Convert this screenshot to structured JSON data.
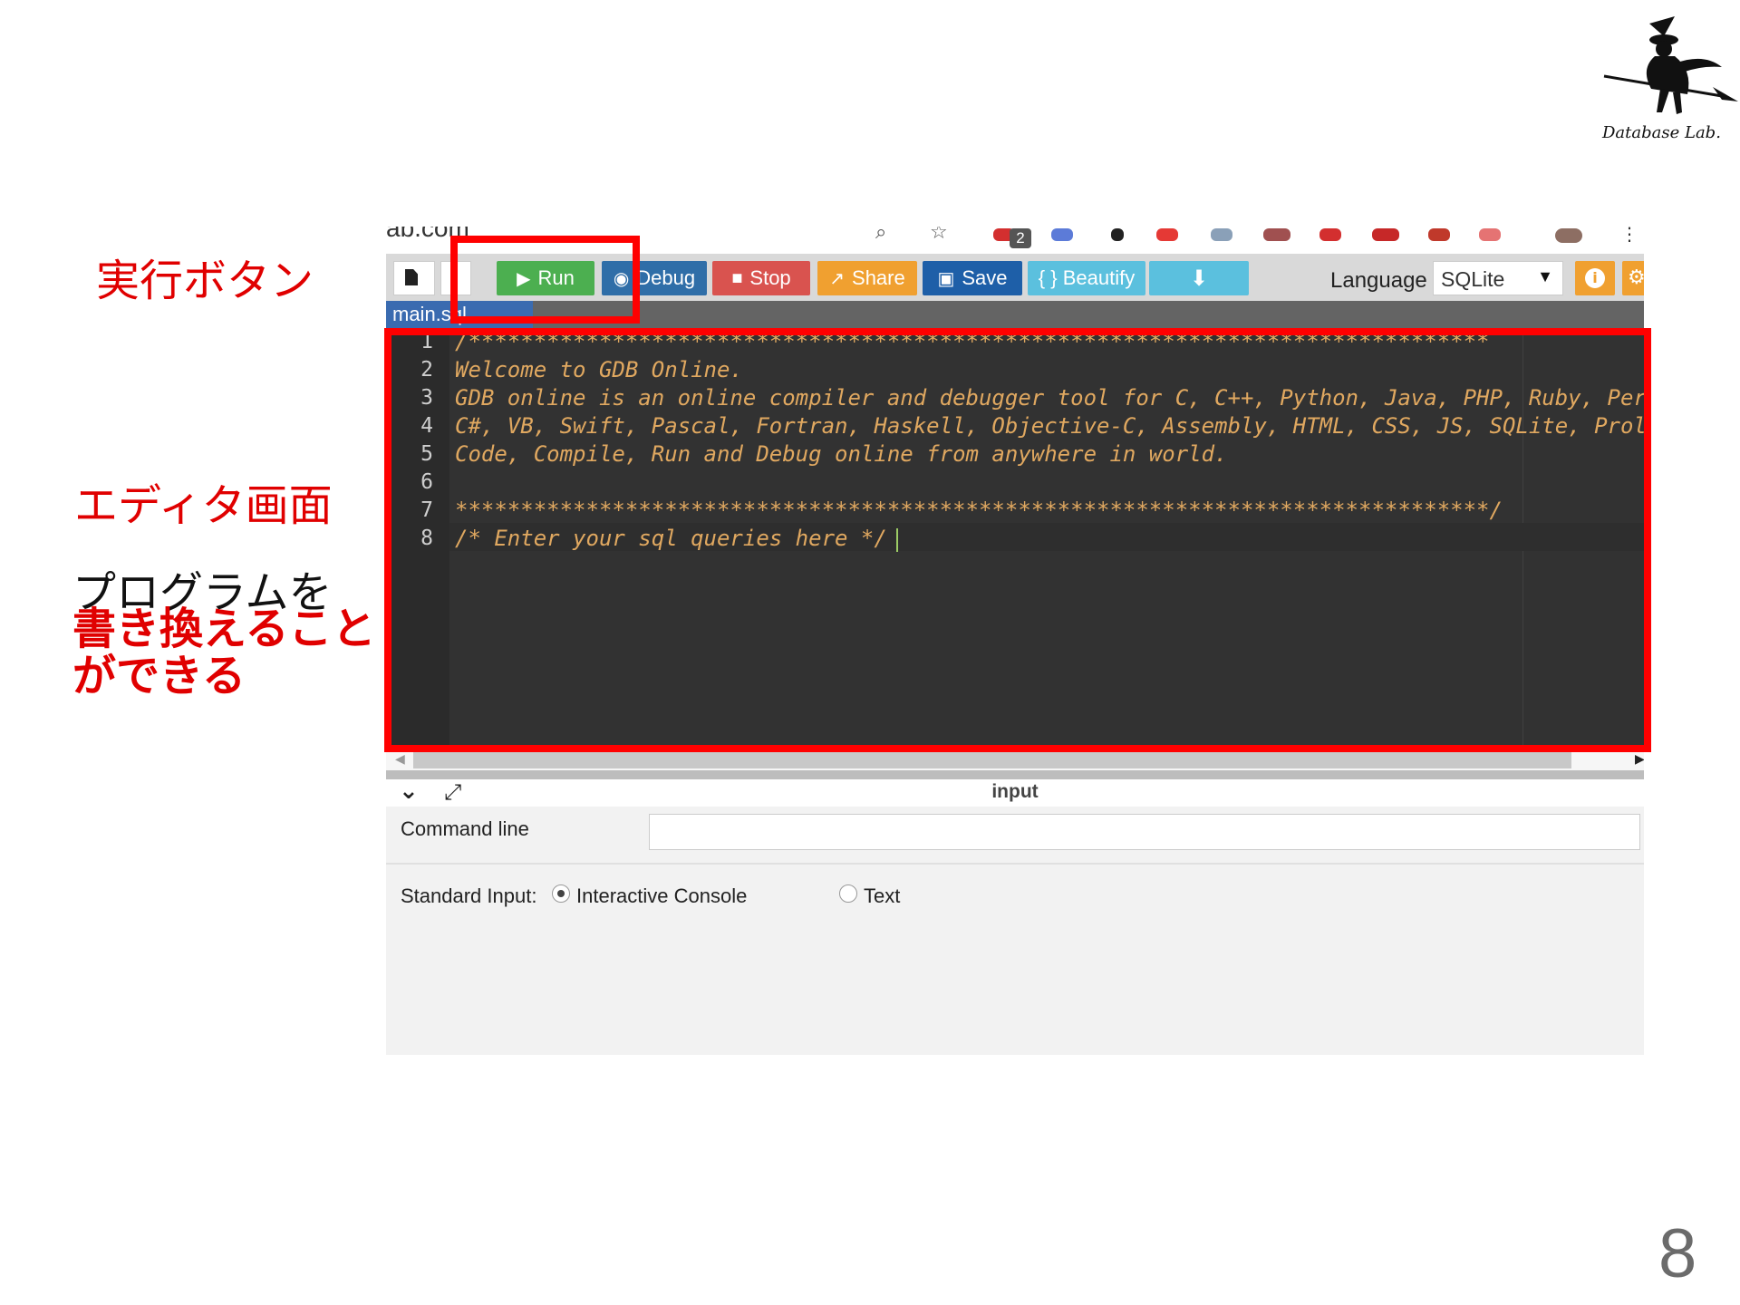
{
  "slide": {
    "anno_run": "実行ボタン",
    "anno_editor": "エディタ画面",
    "anno_line1": "プログラムを",
    "anno_line2": "書き換えること",
    "anno_line3": "ができる",
    "page_number": "8",
    "logo_text": "Database Lab."
  },
  "browser": {
    "url_fragment": "ab.com",
    "extension_badge": "2"
  },
  "toolbar": {
    "run": "Run",
    "debug": "Debug",
    "stop": "Stop",
    "share": "Share",
    "save": "Save",
    "beautify": "{ } Beautify",
    "language_label": "Language",
    "language_value": "SQLite"
  },
  "editor": {
    "tab": "main.sql",
    "lines": [
      {
        "n": "1",
        "text": "/******************************************************************************"
      },
      {
        "n": "2",
        "text": "Welcome to GDB Online."
      },
      {
        "n": "3",
        "text": "GDB online is an online compiler and debugger tool for C, C++, Python, Java, PHP, Ruby, Perl,"
      },
      {
        "n": "4",
        "text": "C#, VB, Swift, Pascal, Fortran, Haskell, Objective-C, Assembly, HTML, CSS, JS, SQLite, Prolog."
      },
      {
        "n": "5",
        "text": "Code, Compile, Run and Debug online from anywhere in world."
      },
      {
        "n": "6",
        "text": ""
      },
      {
        "n": "7",
        "text": "*******************************************************************************/"
      },
      {
        "n": "8",
        "text": "/* Enter your sql queries here */"
      }
    ]
  },
  "io": {
    "title": "input",
    "command_line_label": "Command line",
    "command_line_value": "",
    "stdin_label": "Standard Input:",
    "option_console": "Interactive Console",
    "option_text": "Text"
  },
  "colors": {
    "highlight": "#ff0000",
    "run": "#4caf50",
    "debug": "#2f6ea8",
    "stop": "#d9534f",
    "share": "#f0a030",
    "save": "#1e5fa8",
    "beautify": "#5bc0de"
  }
}
